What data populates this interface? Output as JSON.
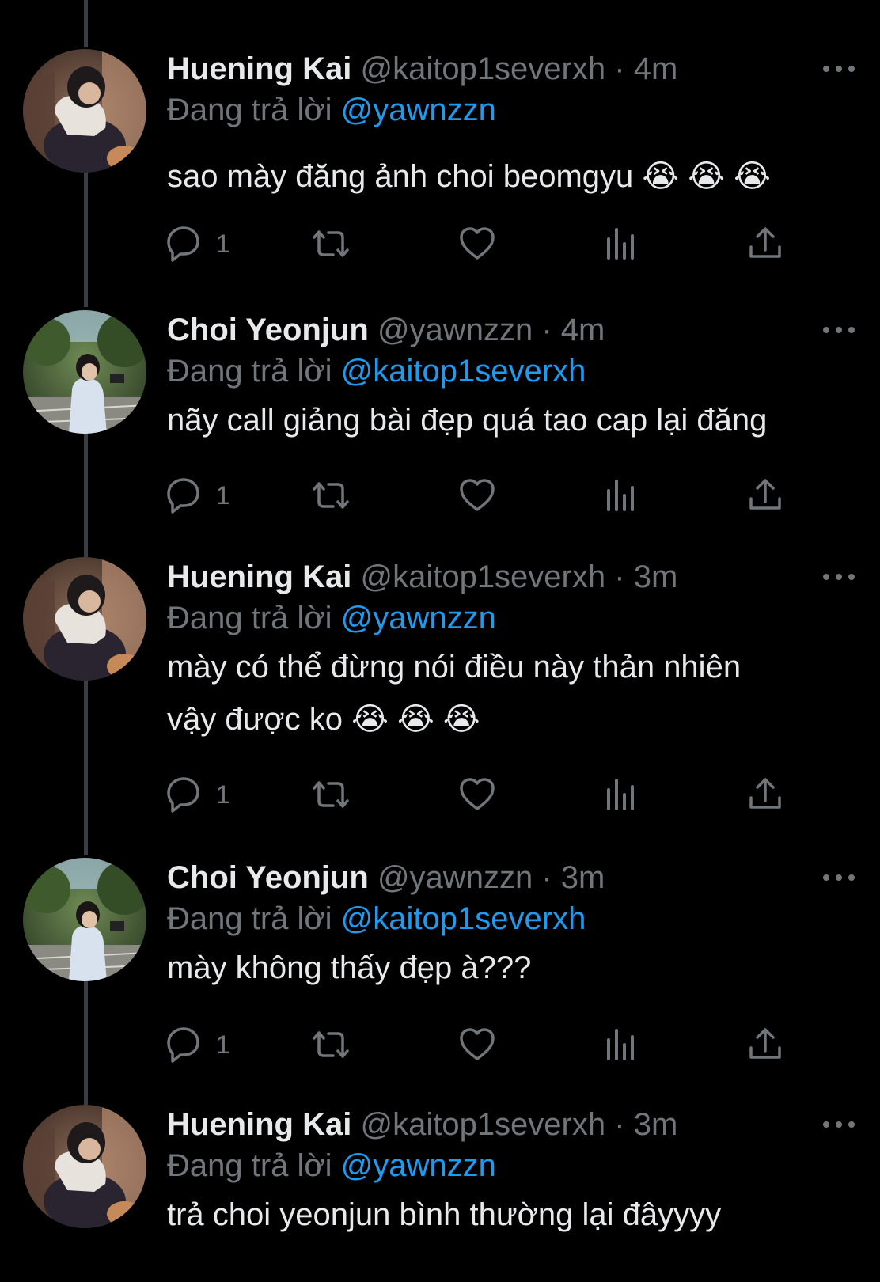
{
  "tweets": [
    {
      "name": "Huening Kai",
      "handle": "@kaitop1severxh",
      "time": "4m",
      "reply_prefix": "Đang trả lời",
      "reply_to": "@yawnzzn",
      "text": "sao mày đăng ảnh choi beomgyu 😭 😭 😭",
      "reply_count": "1",
      "avatar": "kai-avatar"
    },
    {
      "name": "Choi Yeonjun",
      "handle": "@yawnzzn",
      "time": "4m",
      "reply_prefix": "Đang trả lời",
      "reply_to": "@kaitop1severxh",
      "text": "nãy call giảng bài đẹp quá tao cap lại đăng",
      "reply_count": "1",
      "avatar": "yeonjun-avatar"
    },
    {
      "name": "Huening Kai",
      "handle": "@kaitop1severxh",
      "time": "3m",
      "reply_prefix": "Đang trả lời",
      "reply_to": "@yawnzzn",
      "text_line1": "mày có thể đừng nói điều này thản nhiên",
      "text_line2": "vậy được ko 😭 😭 😭",
      "reply_count": "1",
      "avatar": "kai-avatar"
    },
    {
      "name": "Choi Yeonjun",
      "handle": "@yawnzzn",
      "time": "3m",
      "reply_prefix": "Đang trả lời",
      "reply_to": "@kaitop1severxh",
      "text": "mày không thấy đẹp à???",
      "reply_count": "1",
      "avatar": "yeonjun-avatar"
    },
    {
      "name": "Huening Kai",
      "handle": "@kaitop1severxh",
      "time": "3m",
      "reply_prefix": "Đang trả lời",
      "reply_to": "@yawnzzn",
      "text": "trả choi yeonjun bình thường lại đâyyyy",
      "avatar": "kai-avatar"
    }
  ],
  "separator": "·",
  "icons": [
    "reply-icon",
    "retweet-icon",
    "like-icon",
    "views-icon",
    "share-icon",
    "more-icon"
  ],
  "colors": {
    "background": "#000000",
    "primary_text": "#e7e9ea",
    "secondary_text": "#71767b",
    "mention": "#1d9bf0",
    "thread_line": "#3a3d41"
  }
}
